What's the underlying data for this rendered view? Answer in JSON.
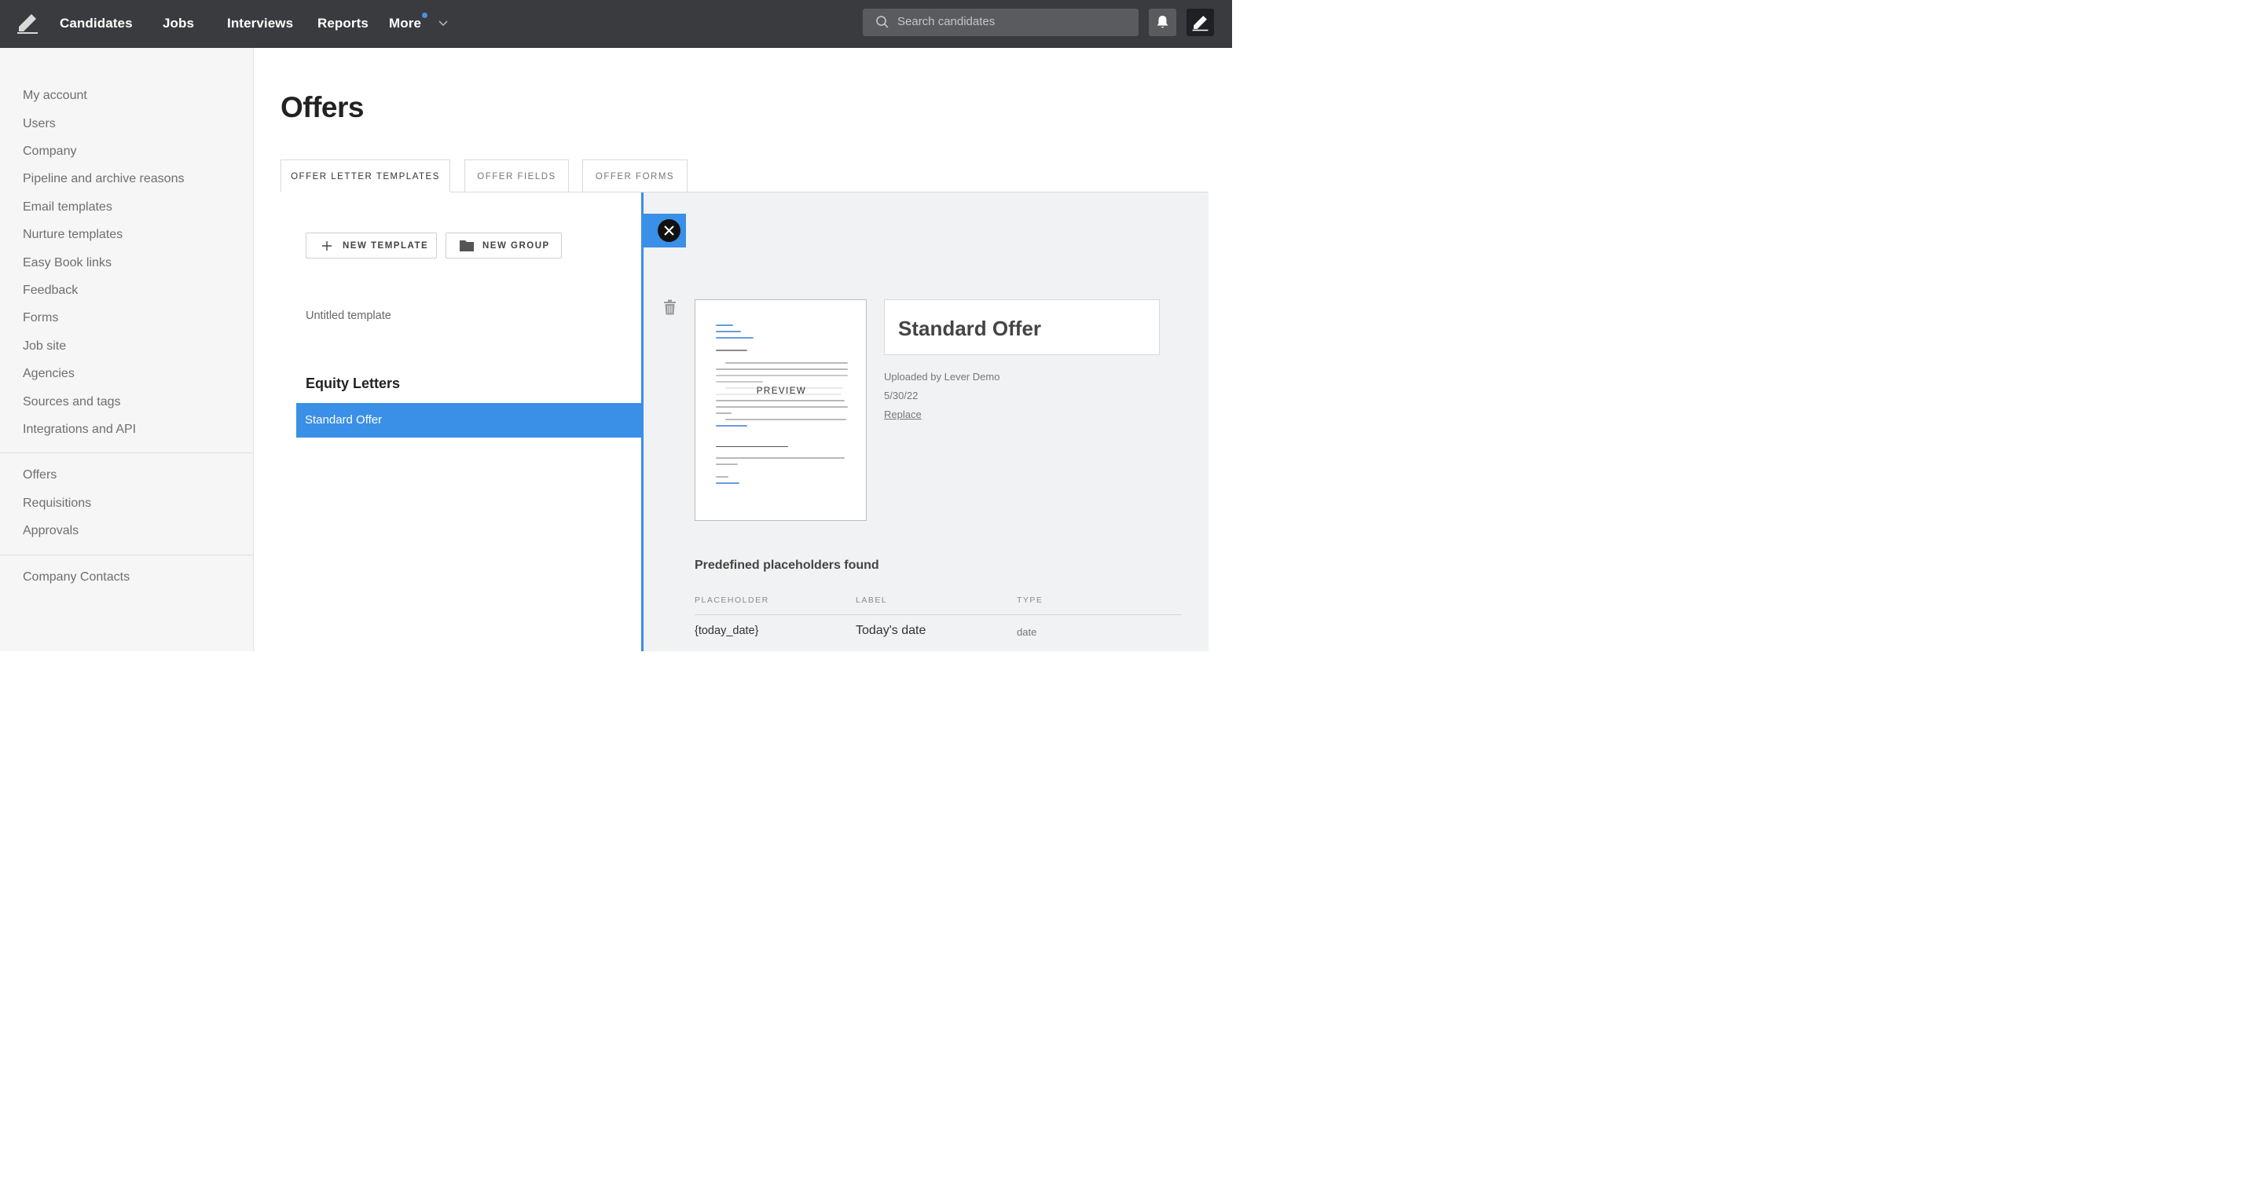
{
  "nav": {
    "items": [
      "Candidates",
      "Jobs",
      "Interviews",
      "Reports",
      "More"
    ],
    "search_placeholder": "Search candidates"
  },
  "sidebar": {
    "group1": [
      "My account",
      "Users",
      "Company",
      "Pipeline and archive reasons",
      "Email templates",
      "Nurture templates",
      "Easy Book links",
      "Feedback",
      "Forms",
      "Job site",
      "Agencies",
      "Sources and tags",
      "Integrations and API"
    ],
    "group2": [
      "Offers",
      "Requisitions",
      "Approvals"
    ],
    "group3": [
      "Company Contacts"
    ]
  },
  "page": {
    "title": "Offers",
    "tabs": [
      "OFFER LETTER TEMPLATES",
      "OFFER FIELDS",
      "OFFER FORMS"
    ]
  },
  "templates": {
    "new_template_label": "NEW TEMPLATE",
    "new_group_label": "NEW GROUP",
    "ungrouped_item": "Untitled template",
    "group_title": "Equity Letters",
    "selected_item": "Standard Offer"
  },
  "detail": {
    "preview_label": "PREVIEW",
    "template_name": "Standard Offer",
    "uploaded_by": "Uploaded by Lever Demo",
    "uploaded_date": "5/30/22",
    "replace_label": "Replace",
    "placeholders_title": "Predefined placeholders found",
    "columns": [
      "PLACEHOLDER",
      "LABEL",
      "TYPE"
    ],
    "rows": [
      {
        "placeholder": "{today_date}",
        "label": "Today's date",
        "type": "date"
      }
    ]
  },
  "colors": {
    "topbar": "#3a3b3e",
    "accent": "#3a8fe6",
    "notification_dot": "#4a90e2"
  }
}
